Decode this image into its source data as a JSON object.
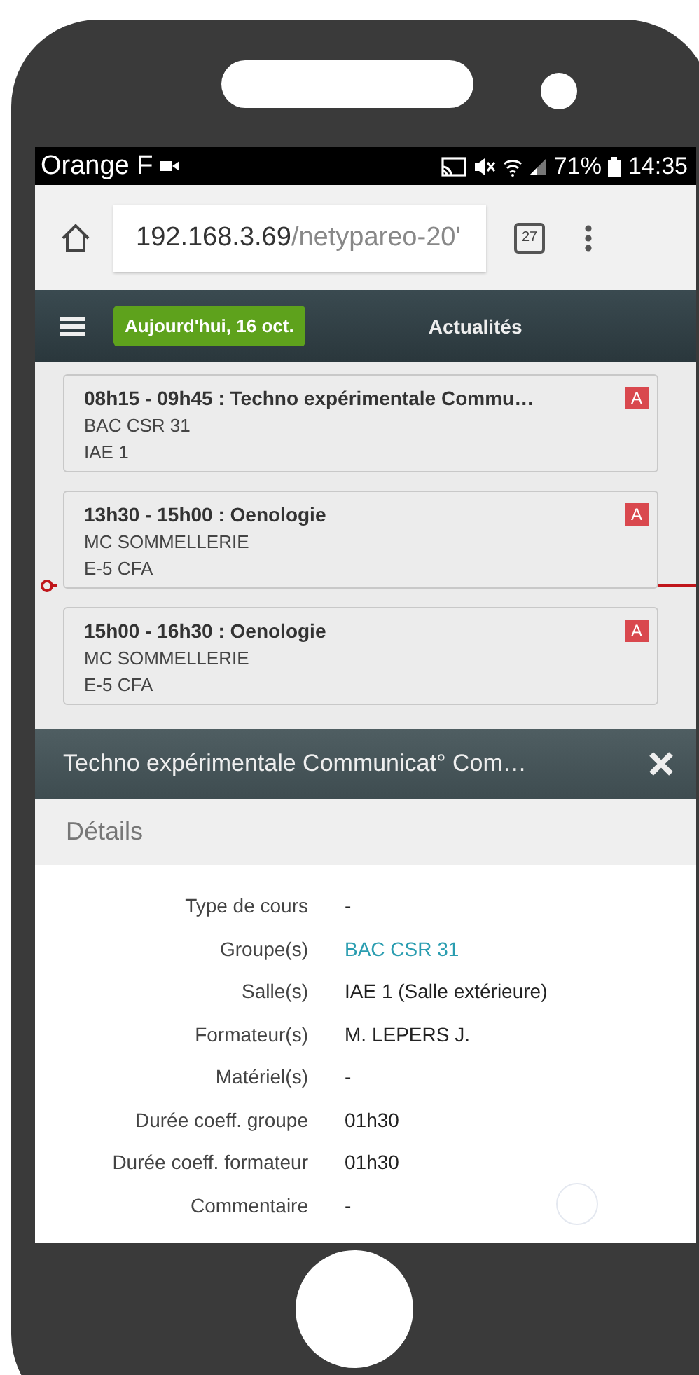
{
  "status_bar": {
    "carrier": "Orange F",
    "battery": "71%",
    "time": "14:35"
  },
  "browser": {
    "url_host": "192.168.3.69",
    "url_path": "/netypareo-20'",
    "tab_count": "27"
  },
  "nav": {
    "today_button": "Aujourd'hui, 16 oct.",
    "news_link": "Actualités"
  },
  "courses": [
    {
      "title": "08h15 - 09h45 : Techno expérimentale Commu…",
      "group": "BAC CSR 31",
      "room": "IAE 1",
      "badge": "A"
    },
    {
      "title": "13h30 - 15h00 : Oenologie",
      "group": "MC SOMMELLERIE",
      "room": "E-5 CFA",
      "badge": "A"
    },
    {
      "title": "15h00 - 16h30 : Oenologie",
      "group": "MC SOMMELLERIE",
      "room": "E-5 CFA",
      "badge": "A"
    }
  ],
  "popup": {
    "title": "Techno expérimentale Communicat° Com…",
    "section": "Détails",
    "rows": [
      {
        "label": "Type de cours",
        "value": "-",
        "kind": "text"
      },
      {
        "label": "Groupe(s)",
        "value": "BAC CSR 31",
        "kind": "link"
      },
      {
        "label": "Salle(s)",
        "value": "IAE 1 (Salle extérieure)",
        "kind": "text"
      },
      {
        "label": "Formateur(s)",
        "value": "M. LEPERS J.",
        "kind": "text"
      },
      {
        "label": "Matériel(s)",
        "value": "-",
        "kind": "text"
      },
      {
        "label": "Durée coeff. groupe",
        "value": "01h30",
        "kind": "text"
      },
      {
        "label": "Durée coeff. formateur",
        "value": "01h30",
        "kind": "text"
      },
      {
        "label": "Commentaire",
        "value": "-",
        "kind": "text"
      }
    ]
  }
}
